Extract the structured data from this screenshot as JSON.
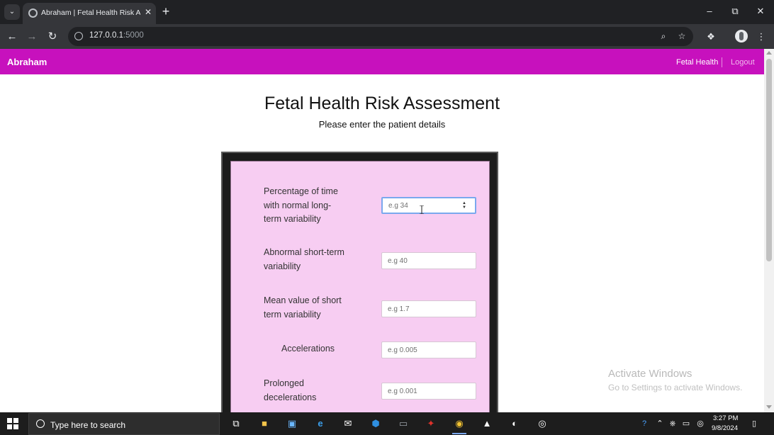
{
  "browser": {
    "tab_title": "Abraham | Fetal Health Risk Ass",
    "url_host": "127.0.0.1",
    "url_port": ":5000",
    "icons": [
      "tab-search-icon",
      "globe-icon",
      "close-icon",
      "plus-icon",
      "minimize-icon",
      "restore-icon",
      "back-icon",
      "forward-icon",
      "reload-icon",
      "site-info-icon",
      "zoom-icon",
      "star-icon",
      "extensions-icon",
      "profile-icon",
      "menu-icon"
    ]
  },
  "app": {
    "colors": {
      "navbar": "#c711bd",
      "form_background": "#f7cdf2",
      "frame": "#1c1c1c"
    },
    "brand": "Abraham",
    "nav": {
      "fetal_health": "Fetal Health",
      "logout": "Logout"
    },
    "title": "Fetal Health Risk Assessment",
    "subtitle": "Please enter the patient details",
    "fields": [
      {
        "label_lines": [
          "Percentage of time",
          "with normal long-",
          "term variability"
        ],
        "placeholder": "e.g 34"
      },
      {
        "label_lines": [
          "Abnormal short-term",
          "variability"
        ],
        "placeholder": "e.g 40"
      },
      {
        "label_lines": [
          "Mean value of short",
          "term variability"
        ],
        "placeholder": "e.g 1.7"
      },
      {
        "label_lines": [
          "Accelerations"
        ],
        "placeholder": "e.g 0.005"
      },
      {
        "label_lines": [
          "Prolonged",
          "decelerations"
        ],
        "placeholder": "e.g 0.001"
      }
    ]
  },
  "windows": {
    "watermark_title": "Activate Windows",
    "watermark_subtitle": "Go to Settings to activate Windows.",
    "search_placeholder": "Type here to search",
    "time": "3:27 PM",
    "date": "9/8/2024"
  }
}
